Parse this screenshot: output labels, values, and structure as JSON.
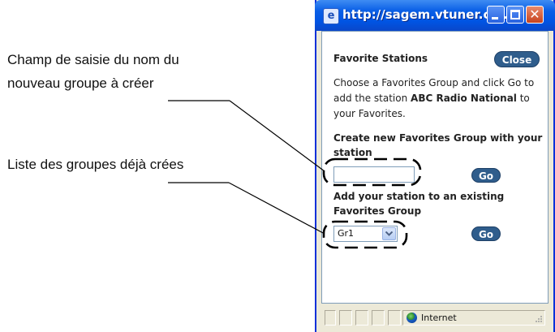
{
  "annotations": {
    "input_callout_line1": "Champ de saisie du nom du",
    "input_callout_line2": "nouveau groupe à créer",
    "list_callout": "Liste des groupes déjà crées"
  },
  "window": {
    "title": "http://sagem.vtuner.co...",
    "page_icon": "ie-page-icon"
  },
  "panel": {
    "title": "Favorite Stations",
    "close_label": "Close",
    "description_prefix": "Choose a Favorites Group and click Go to add the station ",
    "station_name": "ABC Radio National",
    "description_suffix": " to your Favorites.",
    "create_label": "Create new Favorites Group with your station",
    "new_group_value": "",
    "go_label": "Go",
    "add_label": "Add your station to an existing Favorites Group",
    "selected_group": "Gr1",
    "go_label_2": "Go"
  },
  "statusbar": {
    "zone": "Internet"
  },
  "colors": {
    "button_bg": "#2f5d8c",
    "titlebar": "#0054e3"
  }
}
